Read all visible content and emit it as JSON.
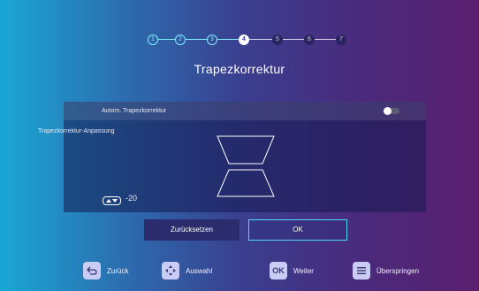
{
  "wizard": {
    "steps": [
      "1",
      "2",
      "3",
      "4",
      "5",
      "6",
      "7"
    ],
    "current_step": 4,
    "title": "Trapezkorrektur"
  },
  "panel": {
    "auto_label": "Autom. Trapezkorrektur",
    "auto_enabled": false,
    "adjust_label": "Trapezkorrektur-Anpassung",
    "value": "-20"
  },
  "buttons": {
    "reset": "Zurücksetzen",
    "ok": "OK"
  },
  "footer": {
    "back": "Zurück",
    "select": "Auswahl",
    "next_key": "OK",
    "next": "Weiter",
    "skip": "Überspringen"
  },
  "icons": {
    "back": "back-arrow-icon",
    "select": "dpad-icon",
    "next": "ok-key-icon",
    "skip": "menu-icon",
    "updown": "up-down-arrows-icon",
    "keystone": "keystone-trapezoid-icon"
  },
  "colors": {
    "accent": "#4ed8f6",
    "step_done": "#7ff1ff",
    "button_reset": "#2a2c6e",
    "icon_bg": "#c9cdf6"
  }
}
